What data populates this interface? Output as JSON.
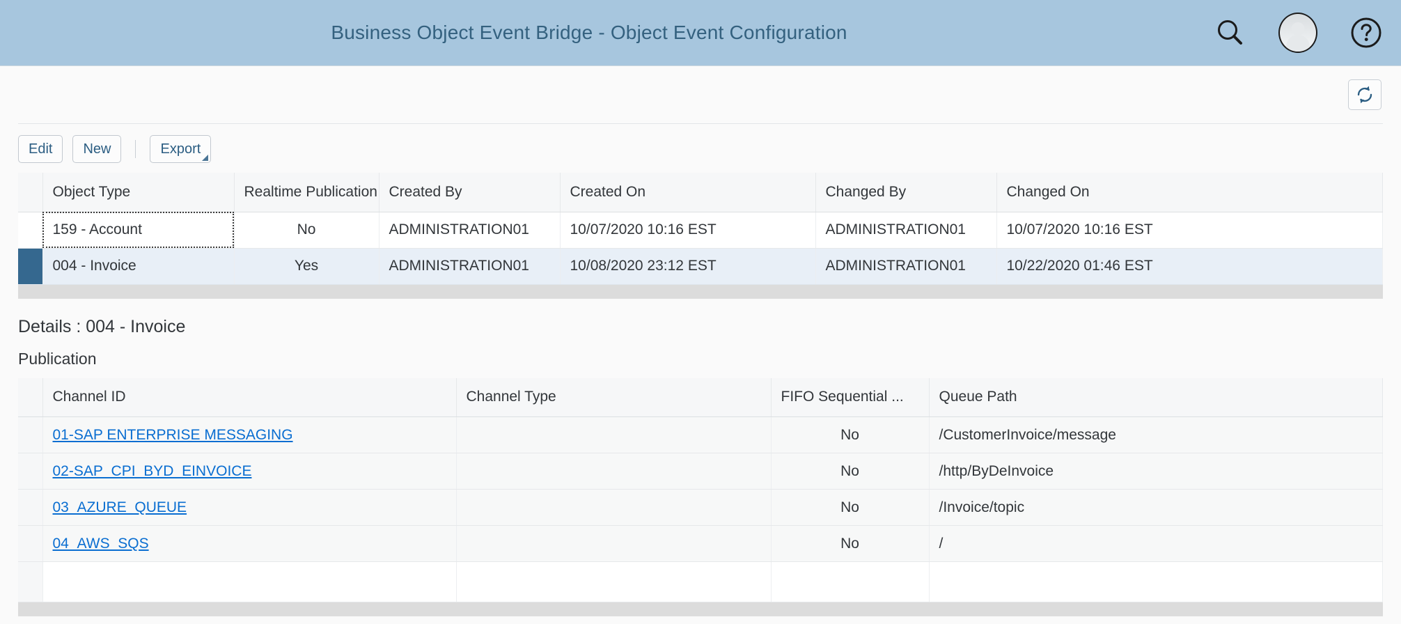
{
  "header": {
    "title": "Business Object Event Bridge - Object Event Configuration",
    "icons": {
      "search": "search-icon",
      "avatar": "user-avatar-icon",
      "help": "help-icon"
    }
  },
  "colors": {
    "header_bg": "#a7c6de",
    "header_text": "#34617f",
    "link": "#0a6ed1",
    "button_text": "#2b5d82",
    "selection_marker": "#35688f",
    "selected_row_bg": "#e8eff7"
  },
  "toolbar": {
    "refresh_label": "refresh-icon",
    "edit_label": "Edit",
    "new_label": "New",
    "export_label": "Export"
  },
  "main_table": {
    "columns": [
      "Object Type",
      "Realtime Publication",
      "Created By",
      "Created On",
      "Changed By",
      "Changed On"
    ],
    "rows": [
      {
        "object_type": "159 - Account",
        "realtime_publication": "No",
        "created_by": "ADMINISTRATION01",
        "created_on": "10/07/2020 10:16 EST",
        "changed_by": "ADMINISTRATION01",
        "changed_on": "10/07/2020 10:16 EST",
        "selected": false,
        "focused_cell": true
      },
      {
        "object_type": "004 - Invoice",
        "realtime_publication": "Yes",
        "created_by": "ADMINISTRATION01",
        "created_on": "10/08/2020 23:12 EST",
        "changed_by": "ADMINISTRATION01",
        "changed_on": "10/22/2020 01:46 EST",
        "selected": true,
        "focused_cell": false
      }
    ]
  },
  "details": {
    "title": "Details : 004 - Invoice",
    "subtitle": "Publication"
  },
  "pub_table": {
    "columns": [
      "Channel ID",
      "Channel Type",
      "FIFO Sequential ...",
      "Queue Path"
    ],
    "rows": [
      {
        "channel_id": "01-SAP ENTERPRISE MESSAGING",
        "channel_type": "",
        "fifo": "No",
        "queue_path": "/CustomerInvoice/message"
      },
      {
        "channel_id": "02-SAP_CPI_BYD_EINVOICE",
        "channel_type": "",
        "fifo": "No",
        "queue_path": "/http/ByDeInvoice"
      },
      {
        "channel_id": "03_AZURE_QUEUE",
        "channel_type": "",
        "fifo": "No",
        "queue_path": "/Invoice/topic"
      },
      {
        "channel_id": "04_AWS_SQS",
        "channel_type": "",
        "fifo": "No",
        "queue_path": "/"
      },
      {
        "channel_id": "",
        "channel_type": "",
        "fifo": "",
        "queue_path": "",
        "empty": true
      }
    ]
  }
}
